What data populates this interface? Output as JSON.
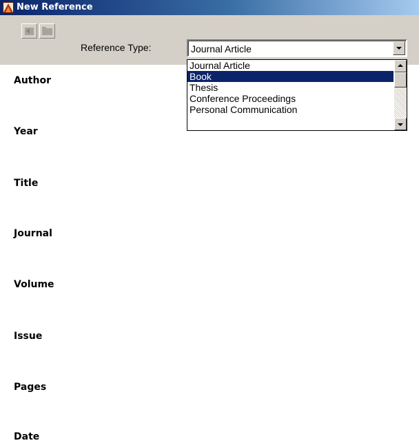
{
  "window": {
    "title": "New Reference"
  },
  "toolbar": {
    "reference_type_label": "Reference Type:",
    "reference_type_value": "Journal Article"
  },
  "dropdown": {
    "options": [
      "Journal Article",
      "Book",
      "Thesis",
      "Conference Proceedings",
      "Personal Communication"
    ],
    "highlighted": "Book"
  },
  "fields": [
    "Author",
    "Year",
    "Title",
    "Journal",
    "Volume",
    "Issue",
    "Pages",
    "Date"
  ],
  "colors": {
    "title_bar_start": "#0a246a",
    "title_bar_end": "#a6caf0",
    "selection": "#0a246a",
    "face": "#d4d0c8"
  }
}
